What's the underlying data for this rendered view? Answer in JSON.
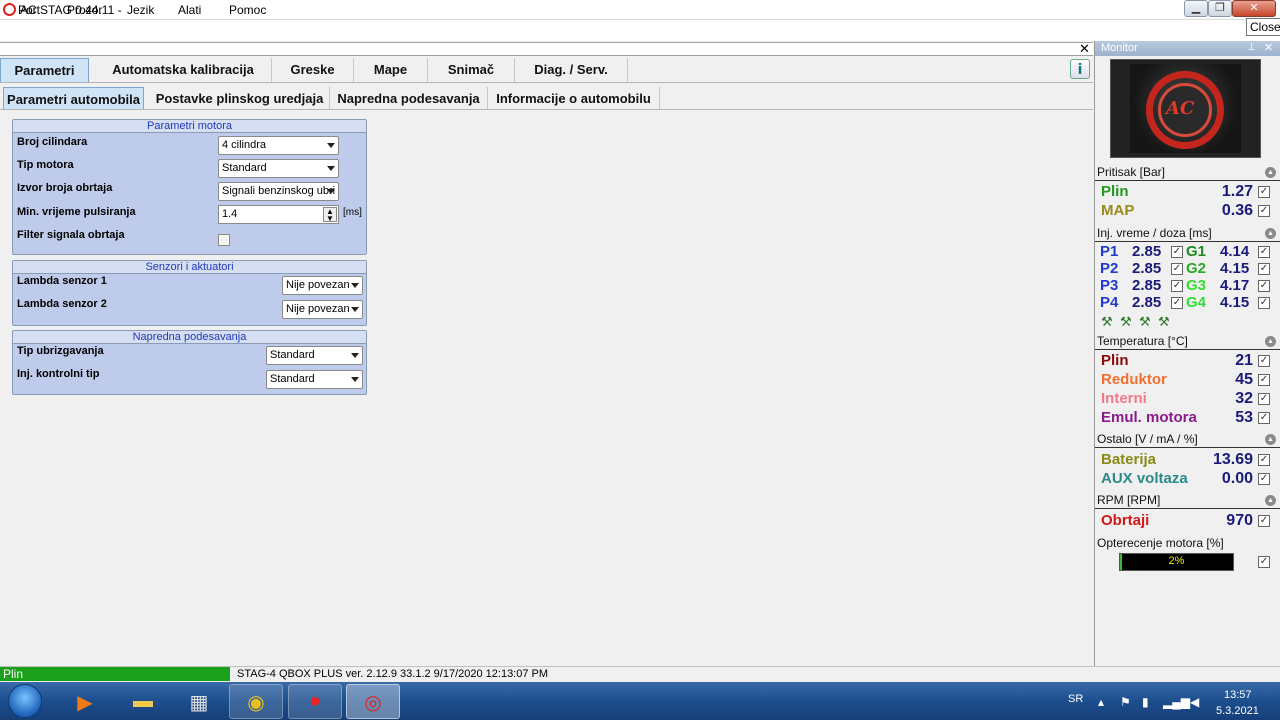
{
  "window": {
    "title": "AC STAG 0.44.11 -",
    "min_glyph": "▁",
    "max_glyph": "❐",
    "close_glyph": "✕",
    "close_tooltip": "Close"
  },
  "menu": [
    "Port",
    "Prozor",
    "Jezik",
    "Alati",
    "Pomoc"
  ],
  "doc_close_glyph": "✕",
  "main_tabs": [
    "Parametri",
    "Automatska kalibracija",
    "Greske",
    "Mape",
    "Snimač",
    "Diag. / Serv."
  ],
  "sub_tabs": [
    "Parametri automobila",
    "Postavke plinskog uredjaja",
    "Napredna podesavanja",
    "Informacije o automobilu"
  ],
  "groups": {
    "motor": {
      "title": "Parametri motora",
      "rows": [
        {
          "label": "Broj cilindara",
          "value": "4 cilindra"
        },
        {
          "label": "Tip motora",
          "value": "Standard"
        },
        {
          "label": "Izvor broja obrtaja",
          "value": "Signali benzinskog ubri"
        },
        {
          "label": "Min. vrijeme pulsiranja",
          "value": "1.4",
          "unit": "[ms]"
        },
        {
          "label": "Filter signala obrtaja"
        }
      ]
    },
    "senzori": {
      "title": "Senzori i aktuatori",
      "rows": [
        {
          "label": "Lambda senzor 1",
          "value": "Nije povezan"
        },
        {
          "label": "Lambda senzor 2",
          "value": "Nije povezan"
        }
      ]
    },
    "napredna": {
      "title": "Napredna podesavanja",
      "rows": [
        {
          "label": "Tip ubrizgavanja",
          "value": "Standard"
        },
        {
          "label": "Inj. kontrolni tip",
          "value": "Standard"
        }
      ]
    }
  },
  "status": {
    "left": "Plin",
    "info": "STAG-4 QBOX PLUS  ver. 2.12.9  33.1.2  9/17/2020 12:13:07 PM"
  },
  "monitor": {
    "title": "Monitor",
    "pin_glyph": "⊥",
    "close_glyph": "✕",
    "collapse_glyph": "▲",
    "check_glyph": "✓",
    "injector_glyph": "⚒",
    "logo_text": "AC",
    "pressure": {
      "title": "Pritisak [Bar]",
      "rows": [
        {
          "label": "Plin",
          "value": "1.27",
          "color": "#1f9a1f"
        },
        {
          "label": "MAP",
          "value": "0.36",
          "color": "#9a8a18"
        }
      ]
    },
    "injection": {
      "title": "Inj. vreme / doza [ms]",
      "petrol": [
        {
          "label": "P1",
          "value": "2.85"
        },
        {
          "label": "P2",
          "value": "2.85"
        },
        {
          "label": "P3",
          "value": "2.85"
        },
        {
          "label": "P4",
          "value": "2.85"
        }
      ],
      "gas": [
        {
          "label": "G1",
          "value": "4.14"
        },
        {
          "label": "G2",
          "value": "4.15"
        },
        {
          "label": "G3",
          "value": "4.17"
        },
        {
          "label": "G4",
          "value": "4.15"
        }
      ],
      "petrol_color": "#1f3ad0",
      "gas_colors": [
        "#1f8a1f",
        "#2aa82a",
        "#33dd33",
        "#33dd33"
      ]
    },
    "temperature": {
      "title": "Temperatura [°C]",
      "rows": [
        {
          "label": "Plin",
          "value": "21",
          "color": "#8a0a0a"
        },
        {
          "label": "Reduktor",
          "value": "45",
          "color": "#f07030"
        },
        {
          "label": "Interni",
          "value": "32",
          "color": "#f07a8a"
        },
        {
          "label": "Emul. motora",
          "value": "53",
          "color": "#8a1a8a"
        }
      ]
    },
    "other": {
      "title": "Ostalo [V / mA / %]",
      "rows": [
        {
          "label": "Baterija",
          "value": "13.69",
          "color": "#8a8a1a"
        },
        {
          "label": "AUX voltaza",
          "value": "0.00",
          "color": "#2a8a8a"
        }
      ]
    },
    "rpm": {
      "title": "RPM [RPM]",
      "rows": [
        {
          "label": "Obrtaji",
          "value": "970",
          "color": "#d01818"
        }
      ]
    },
    "load": {
      "title": "Opterecenje motora [%]",
      "value_text": "2%",
      "fraction": 0.02
    }
  },
  "taskbar": {
    "lang": "SR",
    "time": "13:57",
    "date": "5.3.2021"
  }
}
